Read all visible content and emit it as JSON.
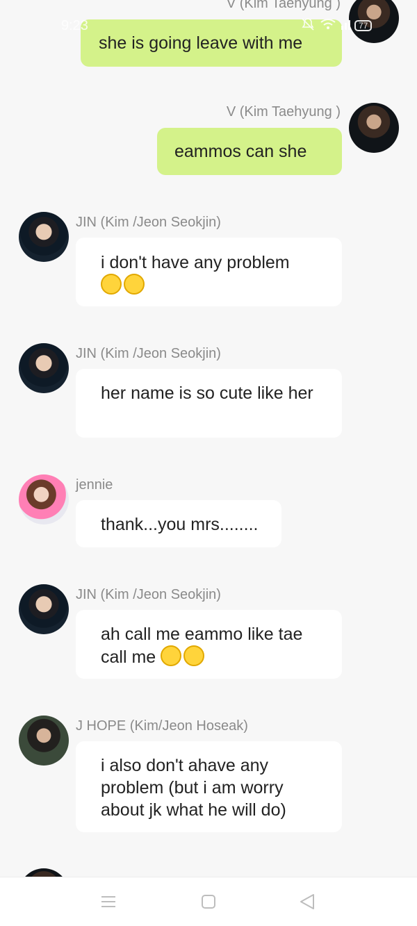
{
  "status_bar": {
    "time": "9:23",
    "battery": "77"
  },
  "messages": [
    {
      "direction": "out",
      "sender": "V (Kim Taehyung )",
      "text": "she is going leave with me",
      "avatar": "v-avatar"
    },
    {
      "direction": "out",
      "sender": "V (Kim Taehyung )",
      "text": "eammos can she",
      "avatar": "v-avatar"
    },
    {
      "direction": "in",
      "sender": "JIN (Kim /Jeon Seokjin)",
      "text": "i don't have any problem",
      "emoji_count": 2,
      "avatar": "jin-avatar"
    },
    {
      "direction": "in",
      "sender": "JIN (Kim /Jeon Seokjin)",
      "text": "her name is so cute like her",
      "avatar": "jin-avatar"
    },
    {
      "direction": "in",
      "sender": "jennie",
      "text": "thank...you mrs........",
      "avatar": "jennie-avatar"
    },
    {
      "direction": "in",
      "sender": "JIN (Kim /Jeon Seokjin)",
      "text": "ah call me eammo like tae call me",
      "emoji_count": 2,
      "avatar": "jin-avatar"
    },
    {
      "direction": "in",
      "sender": "J HOPE (Kim/Jeon Hoseak)",
      "text": "i also don't ahave any problem (but i am worry about jk what he will do)",
      "avatar": "jhope-avatar"
    }
  ],
  "nav_bar": {
    "icons": [
      "menu-icon",
      "home-square-icon",
      "back-triangle-icon"
    ]
  },
  "colors": {
    "background": "#f7f7f7",
    "outgoing_bubble": "#d4f28a",
    "incoming_bubble": "#ffffff",
    "sender_text": "#8a8a8a"
  }
}
